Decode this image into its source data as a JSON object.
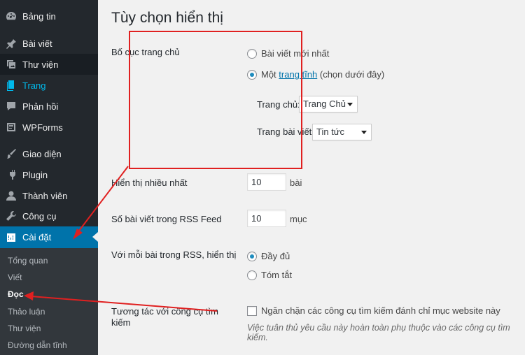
{
  "sidebar": {
    "items": [
      {
        "label": "Bảng tin",
        "icon": "dashboard-icon"
      },
      {
        "label": "Bài viết",
        "icon": "pin-icon"
      },
      {
        "label": "Thư viện",
        "icon": "media-icon"
      },
      {
        "label": "Trang",
        "icon": "page-icon"
      },
      {
        "label": "Phản hồi",
        "icon": "comment-icon"
      },
      {
        "label": "WPForms",
        "icon": "forms-icon"
      },
      {
        "label": "Giao diện",
        "icon": "brush-icon"
      },
      {
        "label": "Plugin",
        "icon": "plugin-icon"
      },
      {
        "label": "Thành viên",
        "icon": "user-icon"
      },
      {
        "label": "Công cụ",
        "icon": "wrench-icon"
      },
      {
        "label": "Cài đặt",
        "icon": "settings-icon"
      }
    ],
    "submenu": [
      "Tổng quan",
      "Viết",
      "Đọc",
      "Thảo luận",
      "Thư viện",
      "Đường dẫn tĩnh"
    ]
  },
  "page": {
    "title": "Tùy chọn hiển thị",
    "homepage": {
      "label": "Bố cục trang chủ",
      "option_latest": "Bài viết mới nhất",
      "option_static_prefix": "Một",
      "option_static_link": "trang tĩnh",
      "option_static_suffix": "(chọn dưới đây)",
      "homepage_label": "Trang chủ:",
      "homepage_value": "Trang Chủ",
      "posts_label": "Trang bài viết:",
      "posts_value": "Tin tức"
    },
    "posts_per_page": {
      "label": "Hiển thị nhiều nhất",
      "value": "10",
      "unit": "bài"
    },
    "rss_count": {
      "label": "Số bài viết trong RSS Feed",
      "value": "10",
      "unit": "mục"
    },
    "rss_display": {
      "label": "Với mỗi bài trong RSS, hiển thị",
      "option_full": "Đầy đủ",
      "option_summary": "Tóm tắt"
    },
    "search_engine": {
      "label": "Tương tác với công cụ tìm kiếm",
      "checkbox_label": "Ngăn chặn các công cụ tìm kiếm đánh chỉ mục website này",
      "description": "Việc tuân thủ yêu cầu này hoàn toàn phụ thuộc vào các công cụ tìm kiếm."
    }
  },
  "colors": {
    "sidebar": "#23282d",
    "active": "#0073aa",
    "annotation": "#e02020"
  }
}
